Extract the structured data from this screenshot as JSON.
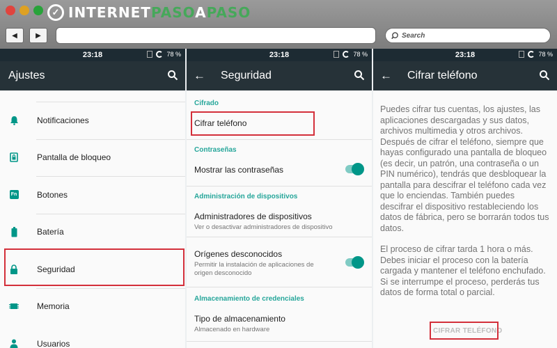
{
  "browser": {
    "logo": {
      "part1": "INTERNET",
      "part2": "PASO",
      "part3": "A",
      "part4": "PASO"
    },
    "search_placeholder": "Search",
    "colors": {
      "close": "#e0443e",
      "minimize": "#dea123",
      "maximize": "#28a33a",
      "logo_accent": "#46a85a"
    }
  },
  "status": {
    "time": "23:18",
    "battery": "78 %"
  },
  "panel1": {
    "title": "Ajustes",
    "items": [
      {
        "label": "Notificaciones",
        "icon": "bell-icon"
      },
      {
        "label": "Pantalla de bloqueo",
        "icon": "lock-screen-icon"
      },
      {
        "label": "Botones",
        "icon": "fn-key-icon",
        "icon_text": "Fn"
      },
      {
        "label": "Batería",
        "icon": "battery-icon"
      },
      {
        "label": "Seguridad",
        "icon": "lock-icon"
      },
      {
        "label": "Memoria",
        "icon": "memory-chip-icon"
      },
      {
        "label": "Usuarios",
        "icon": "person-icon"
      }
    ]
  },
  "panel2": {
    "title": "Seguridad",
    "sections": {
      "cifrado": "Cifrado",
      "contrasenas": "Contraseñas",
      "admin": "Administración de dispositivos",
      "credenciales": "Almacenamiento de credenciales"
    },
    "rows": {
      "cifrar": {
        "main": "Cifrar teléfono"
      },
      "mostrar": {
        "main": "Mostrar las contraseñas"
      },
      "administradores": {
        "main": "Administradores de dispositivos",
        "sub": "Ver o desactivar administradores de dispositivo"
      },
      "origenes": {
        "main": "Orígenes desconocidos",
        "sub1": "Permitir la instalación de aplicaciones de",
        "sub2": "origen desconocido"
      },
      "tipo": {
        "main": "Tipo de almacenamiento",
        "sub": "Almacenado en hardware"
      }
    },
    "accent": "#26a69a"
  },
  "panel3": {
    "title": "Cifrar teléfono",
    "paragraph1": "Puedes cifrar tus cuentas, los ajustes, las aplicaciones descargadas y sus datos, archivos multimedia y otros archivos. Después de cifrar el teléfono, siempre que hayas configurado una pantalla de bloqueo (es decir, un patrón, una contraseña o un PIN numérico), tendrás que desbloquear la pantalla para descifrar el teléfono cada vez que lo enciendas. También puedes descifrar el dispositivo restableciendo los datos de fábrica, pero se borrarán todos tus datos.",
    "paragraph2": "El proceso de cifrar tarda 1 hora o más. Debes iniciar el proceso con la batería cargada y mantener el teléfono enchufado. Si se interrumpe el proceso, perderás tus datos de forma total o parcial.",
    "button": "CIFRAR TELÉFONO"
  },
  "highlight_color": "#d32f3a"
}
